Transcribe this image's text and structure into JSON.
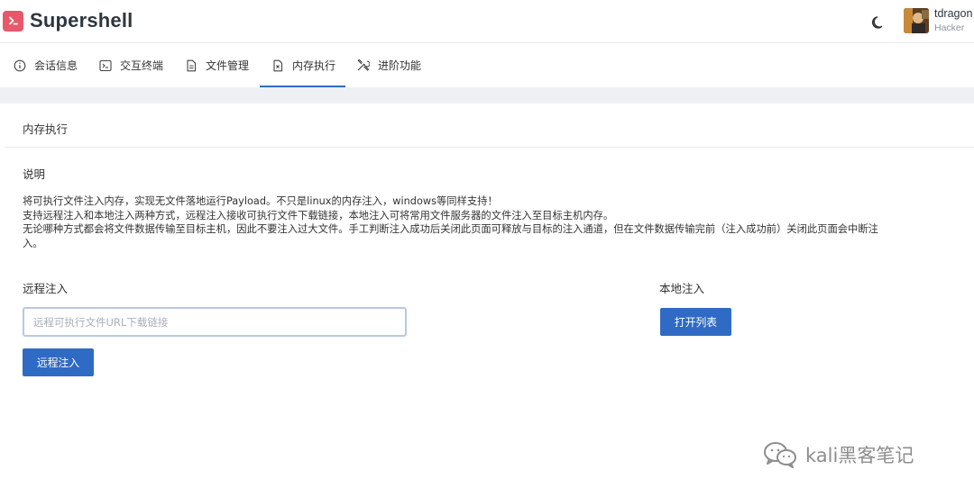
{
  "app": {
    "name": "Supershell",
    "accent": "#2f6bc4",
    "brand_color": "#e8586a"
  },
  "user": {
    "name": "tdragon",
    "role": "Hacker"
  },
  "tabs": [
    {
      "label": "会话信息",
      "icon": "info-icon"
    },
    {
      "label": "交互终端",
      "icon": "terminal-icon"
    },
    {
      "label": "文件管理",
      "icon": "file-icon"
    },
    {
      "label": "内存执行",
      "icon": "memory-file-icon",
      "active": true
    },
    {
      "label": "进阶功能",
      "icon": "tools-icon"
    }
  ],
  "card": {
    "title": "内存执行",
    "desc_title": "说明",
    "desc_lines": [
      "将可执行文件注入内存，实现无文件落地运行Payload。不只是linux的内存注入，windows等同样支持！",
      "支持远程注入和本地注入两种方式，远程注入接收可执行文件下载链接，本地注入可将常用文件服务器的文件注入至目标主机内存。",
      "无论哪种方式都会将文件数据传输至目标主机，因此不要注入过大文件。手工判断注入成功后关闭此页面可释放与目标的注入通道，但在文件数据传输完前（注入成功前）关闭此页面会中断注",
      "入。"
    ],
    "remote": {
      "title": "远程注入",
      "placeholder": "远程可执行文件URL下载链接",
      "value": "",
      "button": "远程注入"
    },
    "local": {
      "title": "本地注入",
      "button": "打开列表"
    }
  },
  "watermark": "kali黑客笔记"
}
